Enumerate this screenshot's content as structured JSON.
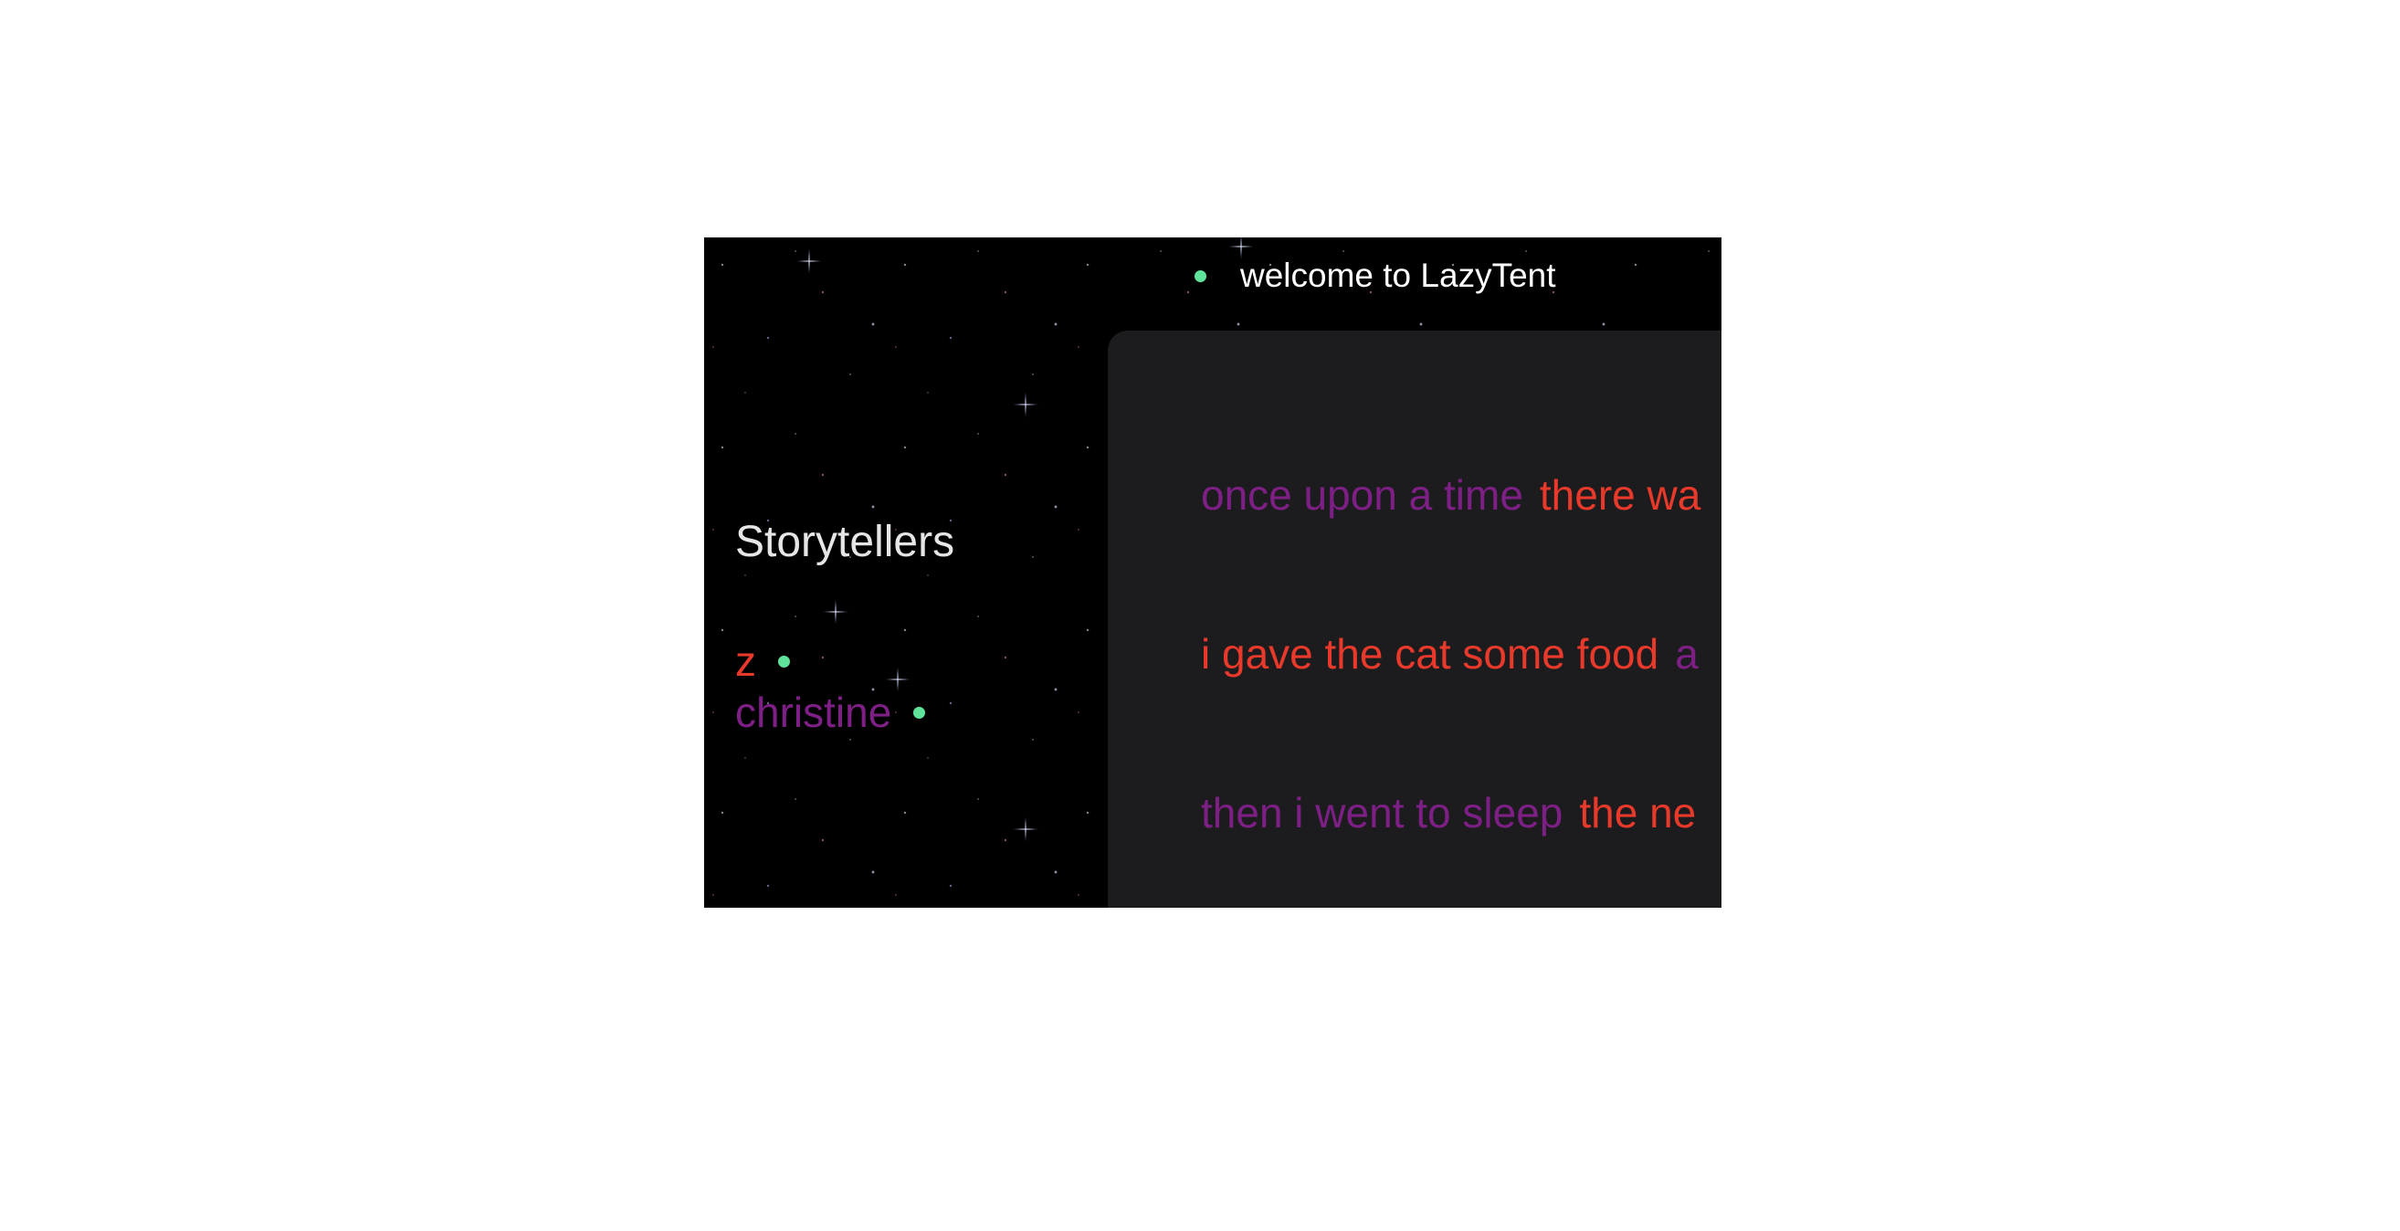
{
  "header": {
    "status_icon": "online-dot-icon",
    "title": "welcome to LazyTent"
  },
  "sidebar": {
    "heading": "Storytellers",
    "users": [
      {
        "name": "z",
        "color": "#e8392b",
        "status": "online"
      },
      {
        "name": "christine",
        "color": "#7e1f86",
        "status": "online"
      }
    ]
  },
  "story": {
    "lines": [
      [
        {
          "text": "once upon a time",
          "color": "#7e1f86"
        },
        {
          "text": "there wa",
          "color": "#e8392b"
        }
      ],
      [
        {
          "text": "i gave the cat some food",
          "color": "#e8392b"
        },
        {
          "text": "a",
          "color": "#7e1f86"
        }
      ],
      [
        {
          "text": "then i went to sleep",
          "color": "#7e1f86"
        },
        {
          "text": "the ne",
          "color": "#e8392b"
        }
      ]
    ]
  },
  "colors": {
    "background": "#000000",
    "panel": "#1c1c1e",
    "online": "#5fe39a",
    "user_red": "#e8392b",
    "user_purple": "#7e1f86"
  }
}
